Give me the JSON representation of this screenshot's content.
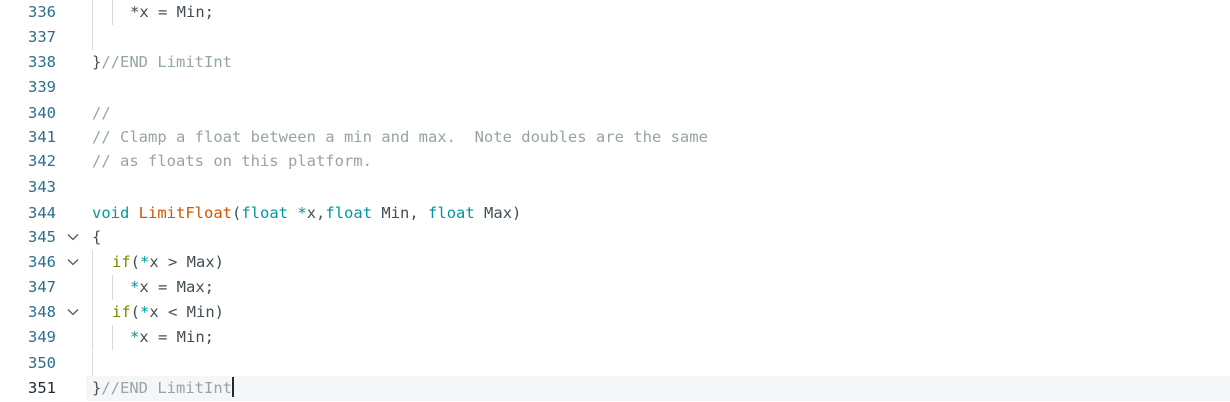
{
  "editor": {
    "lines": [
      {
        "num": "336",
        "tokens": [
          "*x = Min;"
        ]
      },
      {
        "num": "337",
        "tokens": []
      },
      {
        "num": "338",
        "tokens": [
          "}",
          "//END LimitInt"
        ]
      },
      {
        "num": "339",
        "tokens": []
      },
      {
        "num": "340",
        "tokens": [
          "//"
        ]
      },
      {
        "num": "341",
        "tokens": [
          "// Clamp a float between a min and max.  Note doubles are the same"
        ]
      },
      {
        "num": "342",
        "tokens": [
          "// as floats on this platform."
        ]
      },
      {
        "num": "343",
        "tokens": []
      },
      {
        "num": "344",
        "tokens": [
          "void",
          " ",
          "LimitFloat",
          "(",
          "float",
          " ",
          "*",
          "x,",
          "float",
          " Min, ",
          "float",
          " Max)"
        ]
      },
      {
        "num": "345",
        "tokens": [
          "{"
        ]
      },
      {
        "num": "346",
        "tokens": [
          "if",
          "(",
          "*",
          "x > Max)"
        ]
      },
      {
        "num": "347",
        "tokens": [
          "*",
          "x = Max;"
        ]
      },
      {
        "num": "348",
        "tokens": [
          "if",
          "(",
          "*",
          "x < Min)"
        ]
      },
      {
        "num": "349",
        "tokens": [
          "*",
          "x = Min;"
        ]
      },
      {
        "num": "350",
        "tokens": []
      },
      {
        "num": "351",
        "tokens": [
          "}",
          "//END LimitInt"
        ]
      }
    ]
  },
  "icons": {
    "fold": "chevron-down-icon"
  },
  "colors": {
    "comment": "#95a5a6",
    "keyword": "#728e00",
    "type": "#00979d",
    "function": "#d35400",
    "line_number": "#2b6f8e",
    "current_line_bg": "#f4f6f7"
  }
}
